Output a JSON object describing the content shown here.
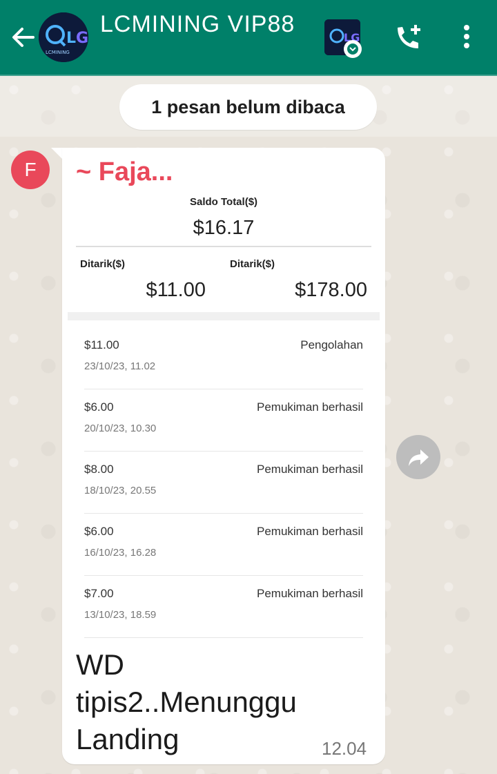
{
  "header": {
    "title": "LCMINING VIP88",
    "avatar_text": "LC",
    "avatar_subtext": "LCMINING",
    "icons": [
      "back-arrow-icon",
      "add-call-icon",
      "more-vert-icon"
    ]
  },
  "unread_notice": "1 pesan belum dibaca",
  "message": {
    "sender_initial": "F",
    "sender_name": "~ Faja...",
    "text_lines": [
      "WD",
      "tipis2..Menunggu",
      "Landing"
    ],
    "time": "12.04"
  },
  "embedded_screenshot": {
    "saldo_label": "Saldo Total($)",
    "saldo_value": "$16.17",
    "ditarik_left_label": "Ditarik($)",
    "ditarik_left_value": "$11.00",
    "ditarik_right_label": "Ditarik($)",
    "ditarik_right_value": "$178.00",
    "transactions": [
      {
        "amount": "$11.00",
        "date": "23/10/23, 11.02",
        "status": "Pengolahan"
      },
      {
        "amount": "$6.00",
        "date": "20/10/23, 10.30",
        "status": "Pemukiman berhasil"
      },
      {
        "amount": "$8.00",
        "date": "18/10/23, 20.55",
        "status": "Pemukiman berhasil"
      },
      {
        "amount": "$6.00",
        "date": "16/10/23, 16.28",
        "status": "Pemukiman berhasil"
      },
      {
        "amount": "$7.00",
        "date": "13/10/23, 18.59",
        "status": "Pemukiman berhasil"
      }
    ]
  },
  "colors": {
    "appbar": "#008069",
    "sender": "#e9485a",
    "wallpaper": "#ece5dd"
  }
}
